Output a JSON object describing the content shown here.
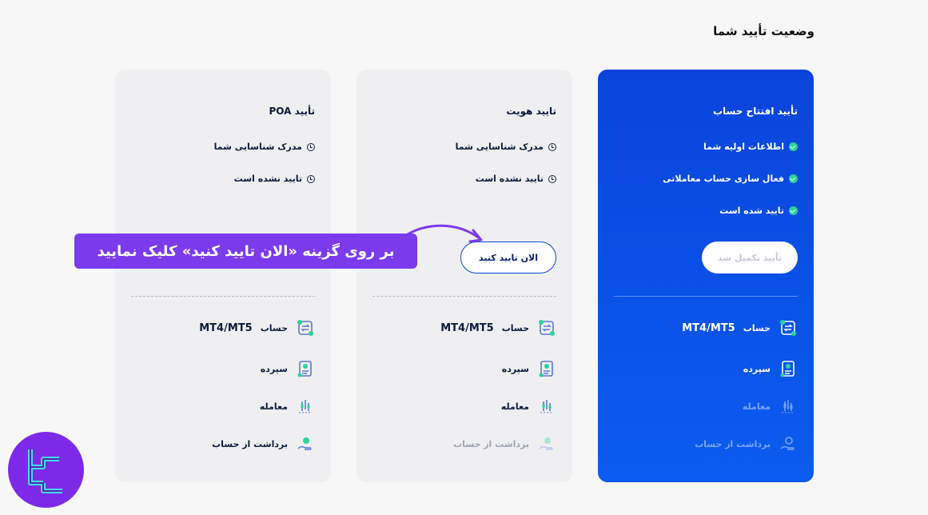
{
  "page": {
    "title": "وضعیت تأیید شما"
  },
  "cards": [
    {
      "title": "تأیید افتتاح حساب",
      "steps": [
        "اطلاعات اولیه شما",
        "فعال سازی حساب معاملاتی",
        "تایید شده است"
      ],
      "button": "تأیید تکمیل شد",
      "features": {
        "account_prefix": "حساب",
        "account_platform": "MT4/MT5",
        "deposit": "سپرده",
        "trade": "معامله",
        "withdraw": "برداشت از حساب"
      }
    },
    {
      "title": "تایید هویت",
      "steps": [
        "مدرک شناسایی شما",
        "تایید نشده است"
      ],
      "button": "الان تایید کنید",
      "features": {
        "account_prefix": "حساب",
        "account_platform": "MT4/MT5",
        "deposit": "سپرده",
        "trade": "معامله",
        "withdraw": "برداشت از حساب"
      }
    },
    {
      "title": "تأیید POA",
      "steps": [
        "مدرک شناسایی شما",
        "تایید نشده است"
      ],
      "features": {
        "account_prefix": "حساب",
        "account_platform": "MT4/MT5",
        "deposit": "سپرده",
        "trade": "معامله",
        "withdraw": "برداشت از حساب"
      }
    }
  ],
  "callout": {
    "text": "بر روی گزینه «الان تایید کنید» کلیک نمایید"
  },
  "colors": {
    "primary_blue": "#0b4fe6",
    "success": "#2ed29b",
    "callout": "#7c3aed",
    "logo": "#7d2ae8"
  },
  "icons": {
    "step_done": "check-circle-icon",
    "step_pending": "clock-icon",
    "account": "sync-account-icon",
    "deposit": "deposit-receipt-icon",
    "trade": "candlestick-icon",
    "withdraw": "hand-coin-icon"
  }
}
